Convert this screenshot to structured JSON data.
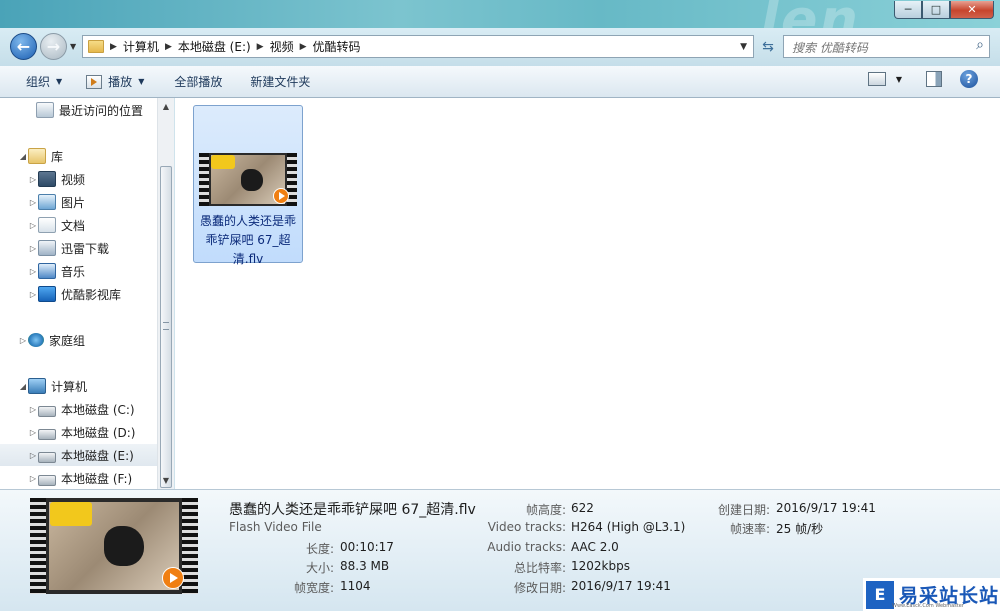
{
  "window": {
    "title_deco": "len",
    "controls": {
      "minimize": "─",
      "maximize": "□",
      "close": "✕"
    }
  },
  "nav": {
    "back_glyph": "←",
    "forward_glyph": "→",
    "breadcrumbs": [
      "计算机",
      "本地磁盘 (E:)",
      "视频",
      "优酷转码"
    ],
    "search_placeholder": "搜索 优酷转码"
  },
  "toolbar": {
    "organize": "组织",
    "play": "播放",
    "play_all": "全部播放",
    "new_folder": "新建文件夹",
    "help": "?"
  },
  "sidebar": {
    "items": [
      {
        "label": "最近访问的位置",
        "icon": "recent-places-icon"
      },
      {
        "label": "库",
        "icon": "library-icon"
      },
      {
        "label": "视频",
        "icon": "videos-icon"
      },
      {
        "label": "图片",
        "icon": "pictures-icon"
      },
      {
        "label": "文档",
        "icon": "documents-icon"
      },
      {
        "label": "迅雷下载",
        "icon": "xunlei-download-icon"
      },
      {
        "label": "音乐",
        "icon": "music-icon"
      },
      {
        "label": "优酷影视库",
        "icon": "youku-icon"
      },
      {
        "label": "家庭组",
        "icon": "homegroup-icon"
      },
      {
        "label": "计算机",
        "icon": "computer-icon"
      },
      {
        "label": "本地磁盘 (C:)",
        "icon": "drive-icon"
      },
      {
        "label": "本地磁盘 (D:)",
        "icon": "drive-icon"
      },
      {
        "label": "本地磁盘 (E:)",
        "icon": "drive-icon"
      },
      {
        "label": "本地磁盘 (F:)",
        "icon": "drive-icon"
      }
    ]
  },
  "files": [
    {
      "name": "愚蠢的人类还是乖乖铲屎吧 67_超清.flv",
      "selected": true
    }
  ],
  "details": {
    "title": "愚蠢的人类还是乖乖铲屎吧 67_超清.flv",
    "type": "Flash Video File",
    "fields": {
      "length_label": "长度:",
      "length": "00:10:17",
      "size_label": "大小:",
      "size": "88.3 MB",
      "width_label": "帧宽度:",
      "width": "1104",
      "height_label": "帧高度:",
      "height": "622",
      "video_label": "Video tracks:",
      "video": "H264 (High @L3.1)",
      "audio_label": "Audio tracks:",
      "audio": "AAC 2.0",
      "bitrate_label": "总比特率:",
      "bitrate": "1202kbps",
      "modified_label": "修改日期:",
      "modified": "2016/9/17 19:41",
      "created_label": "创建日期:",
      "created": "2016/9/17 19:41",
      "fps_label": "帧速率:",
      "fps": "25 帧/秒"
    }
  },
  "watermark": {
    "badge": "E",
    "text": "易采站长站",
    "sub": "Www.Easck.Com Webmaster"
  },
  "colors": {
    "selection_bg": "#c1dcfc",
    "link_text": "#0b2a7a",
    "close_red": "#c7452d"
  }
}
